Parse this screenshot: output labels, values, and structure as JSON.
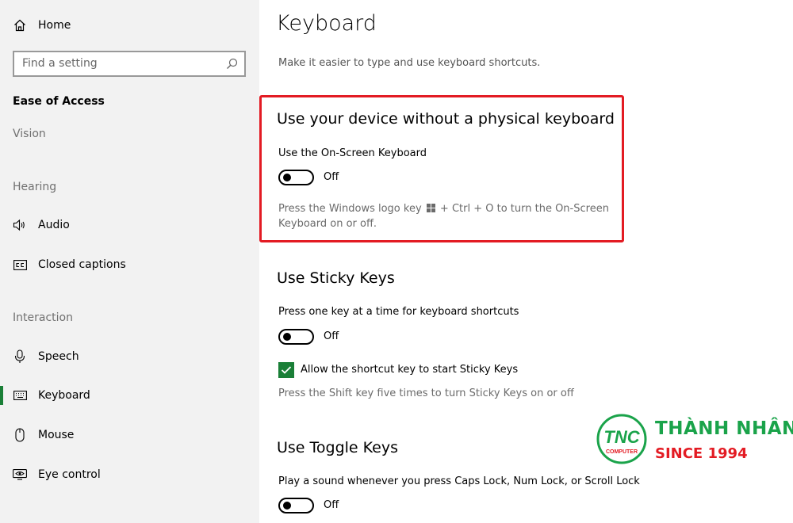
{
  "sidebar": {
    "home": {
      "label": "Home",
      "icon": "home-icon"
    },
    "search": {
      "placeholder": "Find a setting",
      "icon": "search-icon"
    },
    "section_title": "Ease of Access",
    "groups": {
      "vision": "Vision",
      "hearing": "Hearing",
      "interaction": "Interaction"
    },
    "items": {
      "audio": {
        "label": "Audio",
        "icon": "speaker-icon"
      },
      "closed_captions": {
        "label": "Closed captions",
        "icon": "cc-icon"
      },
      "speech": {
        "label": "Speech",
        "icon": "microphone-icon"
      },
      "keyboard": {
        "label": "Keyboard",
        "icon": "keyboard-icon",
        "selected": true
      },
      "mouse": {
        "label": "Mouse",
        "icon": "mouse-icon"
      },
      "eye_control": {
        "label": "Eye control",
        "icon": "eye-control-icon"
      }
    }
  },
  "main": {
    "title": "Keyboard",
    "description": "Make it easier to type and use keyboard shortcuts.",
    "on_screen": {
      "heading": "Use your device without a physical keyboard",
      "label": "Use the On-Screen Keyboard",
      "state": "Off",
      "help_before": "Press the Windows logo key",
      "help_after": "+ Ctrl + O to turn the On-Screen Keyboard on or off."
    },
    "sticky_keys": {
      "heading": "Use Sticky Keys",
      "label": "Press one key at a time for keyboard shortcuts",
      "state": "Off",
      "checkbox_label": "Allow the shortcut key to start Sticky Keys",
      "checkbox_checked": true,
      "help": "Press the Shift key five times to turn Sticky Keys on or off"
    },
    "toggle_keys": {
      "heading": "Use Toggle Keys",
      "label": "Play a sound whenever you press Caps Lock, Num Lock, or Scroll Lock",
      "state": "Off"
    }
  },
  "watermark": {
    "logo_text": "TNC",
    "logo_sub": "COMPUTER",
    "name": "THÀNH NHÂN",
    "since": "SINCE 1994"
  },
  "colors": {
    "accent": "#1a7f37",
    "highlight": "#e31b23",
    "sidebar_bg": "#f2f2f2",
    "brand_green": "#1aa34a"
  }
}
